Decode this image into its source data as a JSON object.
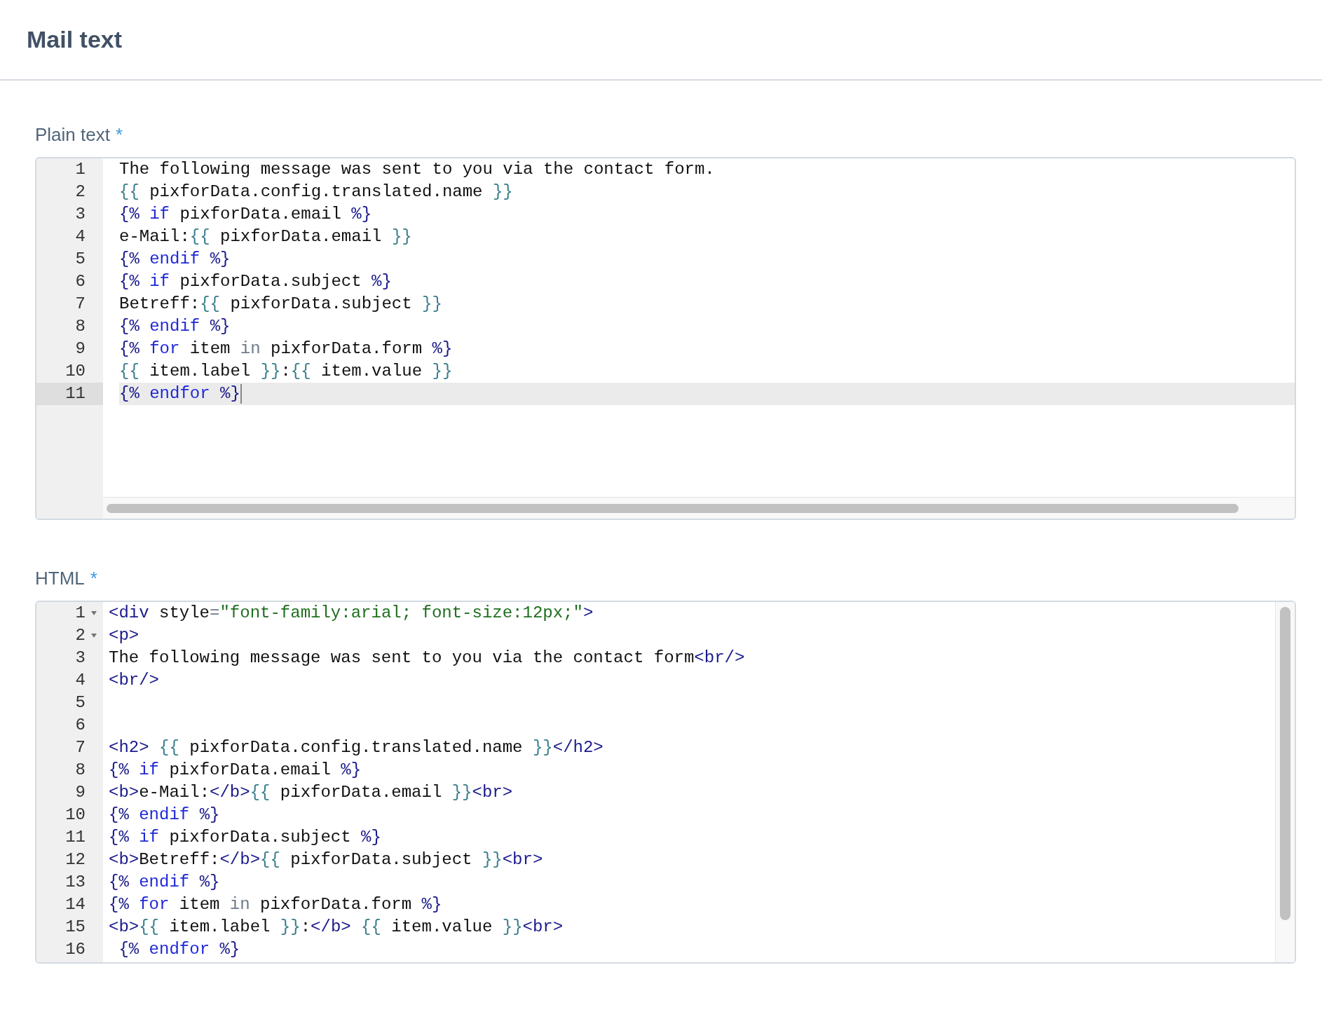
{
  "header": {
    "title": "Mail text"
  },
  "editors": [
    {
      "label": "Plain text",
      "required_mark": "*",
      "kind": "wide",
      "lines": [
        {
          "number": "1",
          "foldable": false,
          "active": false,
          "tokens": [
            {
              "kind": "plain",
              "text": "The following message was sent to you via the contact form."
            }
          ]
        },
        {
          "number": "2",
          "foldable": false,
          "active": false,
          "tokens": [
            {
              "kind": "brace",
              "text": "{{"
            },
            {
              "kind": "plain",
              "text": " pixforData.config.translated.name "
            },
            {
              "kind": "brace",
              "text": "}}"
            }
          ]
        },
        {
          "number": "3",
          "foldable": false,
          "active": false,
          "tokens": [
            {
              "kind": "delim",
              "text": "{%"
            },
            {
              "kind": "keyword",
              "text": " if"
            },
            {
              "kind": "plain",
              "text": " pixforData.email "
            },
            {
              "kind": "delim",
              "text": "%}"
            }
          ]
        },
        {
          "number": "4",
          "foldable": false,
          "active": false,
          "tokens": [
            {
              "kind": "plain",
              "text": "e-Mail:"
            },
            {
              "kind": "brace",
              "text": "{{"
            },
            {
              "kind": "plain",
              "text": " pixforData.email "
            },
            {
              "kind": "brace",
              "text": "}}"
            }
          ]
        },
        {
          "number": "5",
          "foldable": false,
          "active": false,
          "tokens": [
            {
              "kind": "delim",
              "text": "{%"
            },
            {
              "kind": "keyword",
              "text": " endif "
            },
            {
              "kind": "delim",
              "text": "%}"
            }
          ]
        },
        {
          "number": "6",
          "foldable": false,
          "active": false,
          "tokens": [
            {
              "kind": "delim",
              "text": "{%"
            },
            {
              "kind": "keyword",
              "text": " if"
            },
            {
              "kind": "plain",
              "text": " pixforData.subject "
            },
            {
              "kind": "delim",
              "text": "%}"
            }
          ]
        },
        {
          "number": "7",
          "foldable": false,
          "active": false,
          "tokens": [
            {
              "kind": "plain",
              "text": "Betreff:"
            },
            {
              "kind": "brace",
              "text": "{{"
            },
            {
              "kind": "plain",
              "text": " pixforData.subject "
            },
            {
              "kind": "brace",
              "text": "}}"
            }
          ]
        },
        {
          "number": "8",
          "foldable": false,
          "active": false,
          "tokens": [
            {
              "kind": "delim",
              "text": "{%"
            },
            {
              "kind": "keyword",
              "text": " endif "
            },
            {
              "kind": "delim",
              "text": "%}"
            }
          ]
        },
        {
          "number": "9",
          "foldable": false,
          "active": false,
          "tokens": [
            {
              "kind": "delim",
              "text": "{%"
            },
            {
              "kind": "keyword",
              "text": " for"
            },
            {
              "kind": "plain",
              "text": " item "
            },
            {
              "kind": "operator",
              "text": "in"
            },
            {
              "kind": "plain",
              "text": " pixforData.form "
            },
            {
              "kind": "delim",
              "text": "%}"
            }
          ]
        },
        {
          "number": "10",
          "foldable": false,
          "active": false,
          "tokens": [
            {
              "kind": "brace",
              "text": "{{"
            },
            {
              "kind": "plain",
              "text": " item.label "
            },
            {
              "kind": "brace",
              "text": "}}"
            },
            {
              "kind": "plain",
              "text": ":"
            },
            {
              "kind": "brace",
              "text": "{{"
            },
            {
              "kind": "plain",
              "text": " item.value "
            },
            {
              "kind": "brace",
              "text": "}}"
            }
          ]
        },
        {
          "number": "11",
          "foldable": false,
          "active": true,
          "tokens": [
            {
              "kind": "delim",
              "text": "{%"
            },
            {
              "kind": "keyword",
              "text": " endfor "
            },
            {
              "kind": "delim",
              "text": "%}"
            }
          ]
        }
      ]
    },
    {
      "label": "HTML",
      "required_mark": "*",
      "kind": "tall",
      "lines": [
        {
          "number": "1",
          "foldable": true,
          "active": false,
          "tokens": [
            {
              "kind": "tag",
              "text": "<div"
            },
            {
              "kind": "plain",
              "text": " style"
            },
            {
              "kind": "operator",
              "text": "="
            },
            {
              "kind": "string",
              "text": "\"font-family:arial; font-size:12px;\""
            },
            {
              "kind": "tag",
              "text": ">"
            }
          ]
        },
        {
          "number": "2",
          "foldable": true,
          "active": false,
          "tokens": [
            {
              "kind": "tag",
              "text": "<p>"
            }
          ]
        },
        {
          "number": "3",
          "foldable": false,
          "active": false,
          "tokens": [
            {
              "kind": "plain",
              "text": "The following message was sent to you via the contact form"
            },
            {
              "kind": "tag",
              "text": "<br/>"
            }
          ]
        },
        {
          "number": "4",
          "foldable": false,
          "active": false,
          "tokens": [
            {
              "kind": "tag",
              "text": "<br/>"
            }
          ]
        },
        {
          "number": "5",
          "foldable": false,
          "active": false
        },
        {
          "number": "6",
          "foldable": false,
          "active": false
        },
        {
          "number": "7",
          "foldable": false,
          "active": false,
          "tokens": [
            {
              "kind": "tag",
              "text": "<h2>"
            },
            {
              "kind": "brace",
              "text": " {{"
            },
            {
              "kind": "plain",
              "text": " pixforData.config.translated.name "
            },
            {
              "kind": "brace",
              "text": "}}"
            },
            {
              "kind": "tag",
              "text": "</h2>"
            }
          ]
        },
        {
          "number": "8",
          "foldable": false,
          "active": false,
          "tokens": [
            {
              "kind": "delim",
              "text": "{%"
            },
            {
              "kind": "keyword",
              "text": " if"
            },
            {
              "kind": "plain",
              "text": " pixforData.email "
            },
            {
              "kind": "delim",
              "text": "%}"
            }
          ]
        },
        {
          "number": "9",
          "foldable": false,
          "active": false,
          "tokens": [
            {
              "kind": "tag",
              "text": "<b>"
            },
            {
              "kind": "plain",
              "text": "e-Mail:"
            },
            {
              "kind": "tag",
              "text": "</b>"
            },
            {
              "kind": "brace",
              "text": "{{"
            },
            {
              "kind": "plain",
              "text": " pixforData.email "
            },
            {
              "kind": "brace",
              "text": "}}"
            },
            {
              "kind": "tag",
              "text": "<br>"
            }
          ]
        },
        {
          "number": "10",
          "foldable": false,
          "active": false,
          "tokens": [
            {
              "kind": "delim",
              "text": "{%"
            },
            {
              "kind": "keyword",
              "text": " endif "
            },
            {
              "kind": "delim",
              "text": "%}"
            }
          ]
        },
        {
          "number": "11",
          "foldable": false,
          "active": false,
          "tokens": [
            {
              "kind": "delim",
              "text": "{%"
            },
            {
              "kind": "keyword",
              "text": " if"
            },
            {
              "kind": "plain",
              "text": " pixforData.subject "
            },
            {
              "kind": "delim",
              "text": "%}"
            }
          ]
        },
        {
          "number": "12",
          "foldable": false,
          "active": false,
          "tokens": [
            {
              "kind": "tag",
              "text": "<b>"
            },
            {
              "kind": "plain",
              "text": "Betreff:"
            },
            {
              "kind": "tag",
              "text": "</b>"
            },
            {
              "kind": "brace",
              "text": "{{"
            },
            {
              "kind": "plain",
              "text": " pixforData.subject "
            },
            {
              "kind": "brace",
              "text": "}}"
            },
            {
              "kind": "tag",
              "text": "<br>"
            }
          ]
        },
        {
          "number": "13",
          "foldable": false,
          "active": false,
          "tokens": [
            {
              "kind": "delim",
              "text": "{%"
            },
            {
              "kind": "keyword",
              "text": " endif "
            },
            {
              "kind": "delim",
              "text": "%}"
            }
          ]
        },
        {
          "number": "14",
          "foldable": false,
          "active": false,
          "tokens": [
            {
              "kind": "delim",
              "text": "{%"
            },
            {
              "kind": "keyword",
              "text": " for"
            },
            {
              "kind": "plain",
              "text": " item "
            },
            {
              "kind": "operator",
              "text": "in"
            },
            {
              "kind": "plain",
              "text": " pixforData.form "
            },
            {
              "kind": "delim",
              "text": "%}"
            }
          ]
        },
        {
          "number": "15",
          "foldable": false,
          "active": false,
          "tokens": [
            {
              "kind": "tag",
              "text": "<b>"
            },
            {
              "kind": "brace",
              "text": "{{"
            },
            {
              "kind": "plain",
              "text": " item.label "
            },
            {
              "kind": "brace",
              "text": "}}"
            },
            {
              "kind": "plain",
              "text": ":"
            },
            {
              "kind": "tag",
              "text": "</b>"
            },
            {
              "kind": "brace",
              "text": " {{"
            },
            {
              "kind": "plain",
              "text": " item.value "
            },
            {
              "kind": "brace",
              "text": "}}"
            },
            {
              "kind": "tag",
              "text": "<br>"
            }
          ]
        },
        {
          "number": "16",
          "foldable": false,
          "active": false,
          "tokens": [
            {
              "kind": "delim",
              "text": " {%"
            },
            {
              "kind": "keyword",
              "text": " endfor "
            },
            {
              "kind": "delim",
              "text": "%}"
            }
          ]
        }
      ]
    }
  ]
}
